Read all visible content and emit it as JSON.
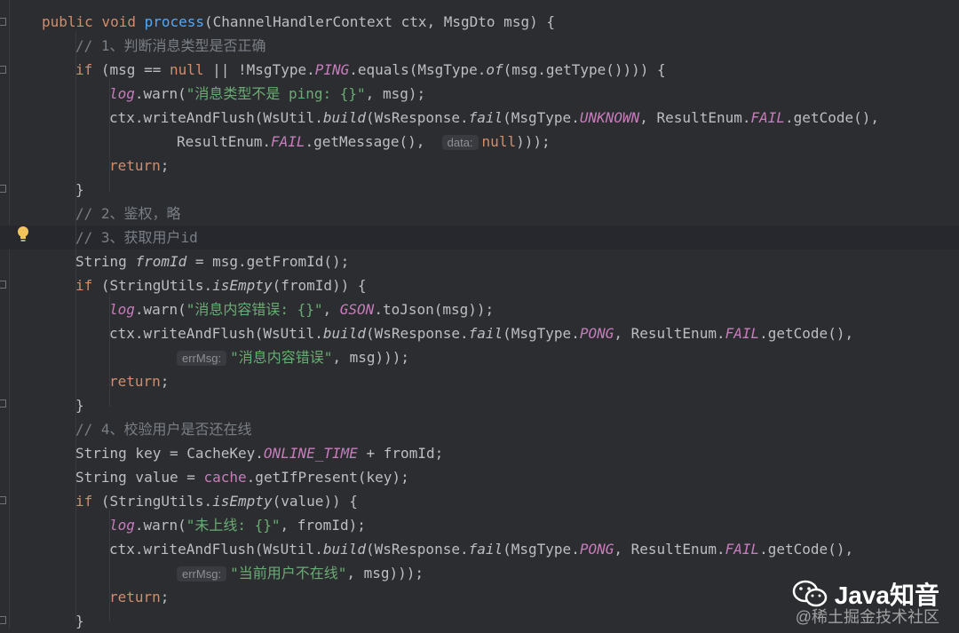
{
  "editor": {
    "language": "Java",
    "theme_background": "#2b2d30",
    "lines": [
      [
        [
          "kw",
          "public void "
        ],
        [
          "fn",
          "process"
        ],
        [
          "",
          "(ChannelHandlerContext ctx, MsgDto msg) {"
        ]
      ],
      [
        [
          "cm",
          "// 1、判断消息类型是否正确"
        ]
      ],
      [
        [
          "kw",
          "if "
        ],
        [
          "",
          "(msg == "
        ],
        [
          "kw",
          "null"
        ],
        [
          "",
          " || !MsgType."
        ],
        [
          "st",
          "PING"
        ],
        [
          "",
          ".equals(MsgType."
        ],
        [
          "it",
          "of"
        ],
        [
          "",
          "(msg.getType()))) {"
        ]
      ],
      [
        [
          "st",
          "log"
        ],
        [
          "",
          ".warn("
        ],
        [
          "str",
          "\"消息类型不是 ping: {}\""
        ],
        [
          "",
          ", msg);"
        ]
      ],
      [
        [
          "",
          "ctx.writeAndFlush(WsUtil."
        ],
        [
          "it",
          "build"
        ],
        [
          "",
          "(WsResponse."
        ],
        [
          "it",
          "fail"
        ],
        [
          "",
          "(MsgType."
        ],
        [
          "st",
          "UNKNOWN"
        ],
        [
          "",
          ", ResultEnum."
        ],
        [
          "st",
          "FAIL"
        ],
        [
          "",
          ".getCode(),"
        ]
      ],
      [
        [
          "",
          "ResultEnum."
        ],
        [
          "st",
          "FAIL"
        ],
        [
          "",
          ".getMessage(),  "
        ],
        [
          "hint",
          "data:"
        ],
        [
          "kw",
          "null"
        ],
        [
          "",
          ")));"
        ]
      ],
      [
        [
          "kw",
          "return"
        ],
        [
          "",
          ";"
        ]
      ],
      [
        [
          "",
          "}"
        ]
      ],
      [
        [
          "cm",
          "// 2、鉴权，略"
        ]
      ],
      [
        [
          "cm",
          "// 3、获取用户id"
        ]
      ],
      [
        [
          "",
          "String "
        ],
        [
          "it",
          "fromId"
        ],
        [
          "",
          " = msg.getFromId();"
        ]
      ],
      [
        [
          "kw",
          "if "
        ],
        [
          "",
          "(StringUtils."
        ],
        [
          "it",
          "isEmpty"
        ],
        [
          "",
          "(fromId)) {"
        ]
      ],
      [
        [
          "st",
          "log"
        ],
        [
          "",
          ".warn("
        ],
        [
          "str",
          "\"消息内容错误: {}\""
        ],
        [
          "",
          ", "
        ],
        [
          "st",
          "GSON"
        ],
        [
          "",
          ".toJson(msg));"
        ]
      ],
      [
        [
          "",
          "ctx.writeAndFlush(WsUtil."
        ],
        [
          "it",
          "build"
        ],
        [
          "",
          "(WsResponse."
        ],
        [
          "it",
          "fail"
        ],
        [
          "",
          "(MsgType."
        ],
        [
          "st",
          "PONG"
        ],
        [
          "",
          ", ResultEnum."
        ],
        [
          "st",
          "FAIL"
        ],
        [
          "",
          ".getCode(),"
        ]
      ],
      [
        [
          "hint",
          "errMsg:"
        ],
        [
          "str",
          "\"消息内容错误\""
        ],
        [
          "",
          ", msg)));"
        ]
      ],
      [
        [
          "kw",
          "return"
        ],
        [
          "",
          ";"
        ]
      ],
      [
        [
          "",
          "}"
        ]
      ],
      [
        [
          "cm",
          "// 4、校验用户是否还在线"
        ]
      ],
      [
        [
          "",
          "String key = CacheKey."
        ],
        [
          "st",
          "ONLINE_TIME"
        ],
        [
          "",
          " + fromId;"
        ]
      ],
      [
        [
          "",
          "String value = "
        ],
        [
          "fld",
          "cache"
        ],
        [
          "",
          ".getIfPresent(key);"
        ]
      ],
      [
        [
          "kw",
          "if "
        ],
        [
          "",
          "(StringUtils."
        ],
        [
          "it",
          "isEmpty"
        ],
        [
          "",
          "(value)) {"
        ]
      ],
      [
        [
          "st",
          "log"
        ],
        [
          "",
          ".warn("
        ],
        [
          "str",
          "\"未上线: {}\""
        ],
        [
          "",
          ", fromId);"
        ]
      ],
      [
        [
          "",
          "ctx.writeAndFlush(WsUtil."
        ],
        [
          "it",
          "build"
        ],
        [
          "",
          "(WsResponse."
        ],
        [
          "it",
          "fail"
        ],
        [
          "",
          "(MsgType."
        ],
        [
          "st",
          "PONG"
        ],
        [
          "",
          ", ResultEnum."
        ],
        [
          "st",
          "FAIL"
        ],
        [
          "",
          ".getCode(),"
        ]
      ],
      [
        [
          "hint",
          "errMsg:"
        ],
        [
          "str",
          "\"当前用户不在线\""
        ],
        [
          "",
          ", msg)));"
        ]
      ],
      [
        [
          "kw",
          "return"
        ],
        [
          "",
          ";"
        ]
      ],
      [
        [
          "",
          "}"
        ]
      ]
    ],
    "indents": [
      47,
      85,
      85,
      123,
      123,
      199,
      123,
      85,
      85,
      85,
      85,
      85,
      123,
      123,
      199,
      123,
      85,
      85,
      85,
      85,
      85,
      123,
      123,
      199,
      123,
      85
    ],
    "current_line": 9
  },
  "watermark": {
    "title": "Java知音",
    "subtitle": "@稀土掘金技术社区"
  }
}
